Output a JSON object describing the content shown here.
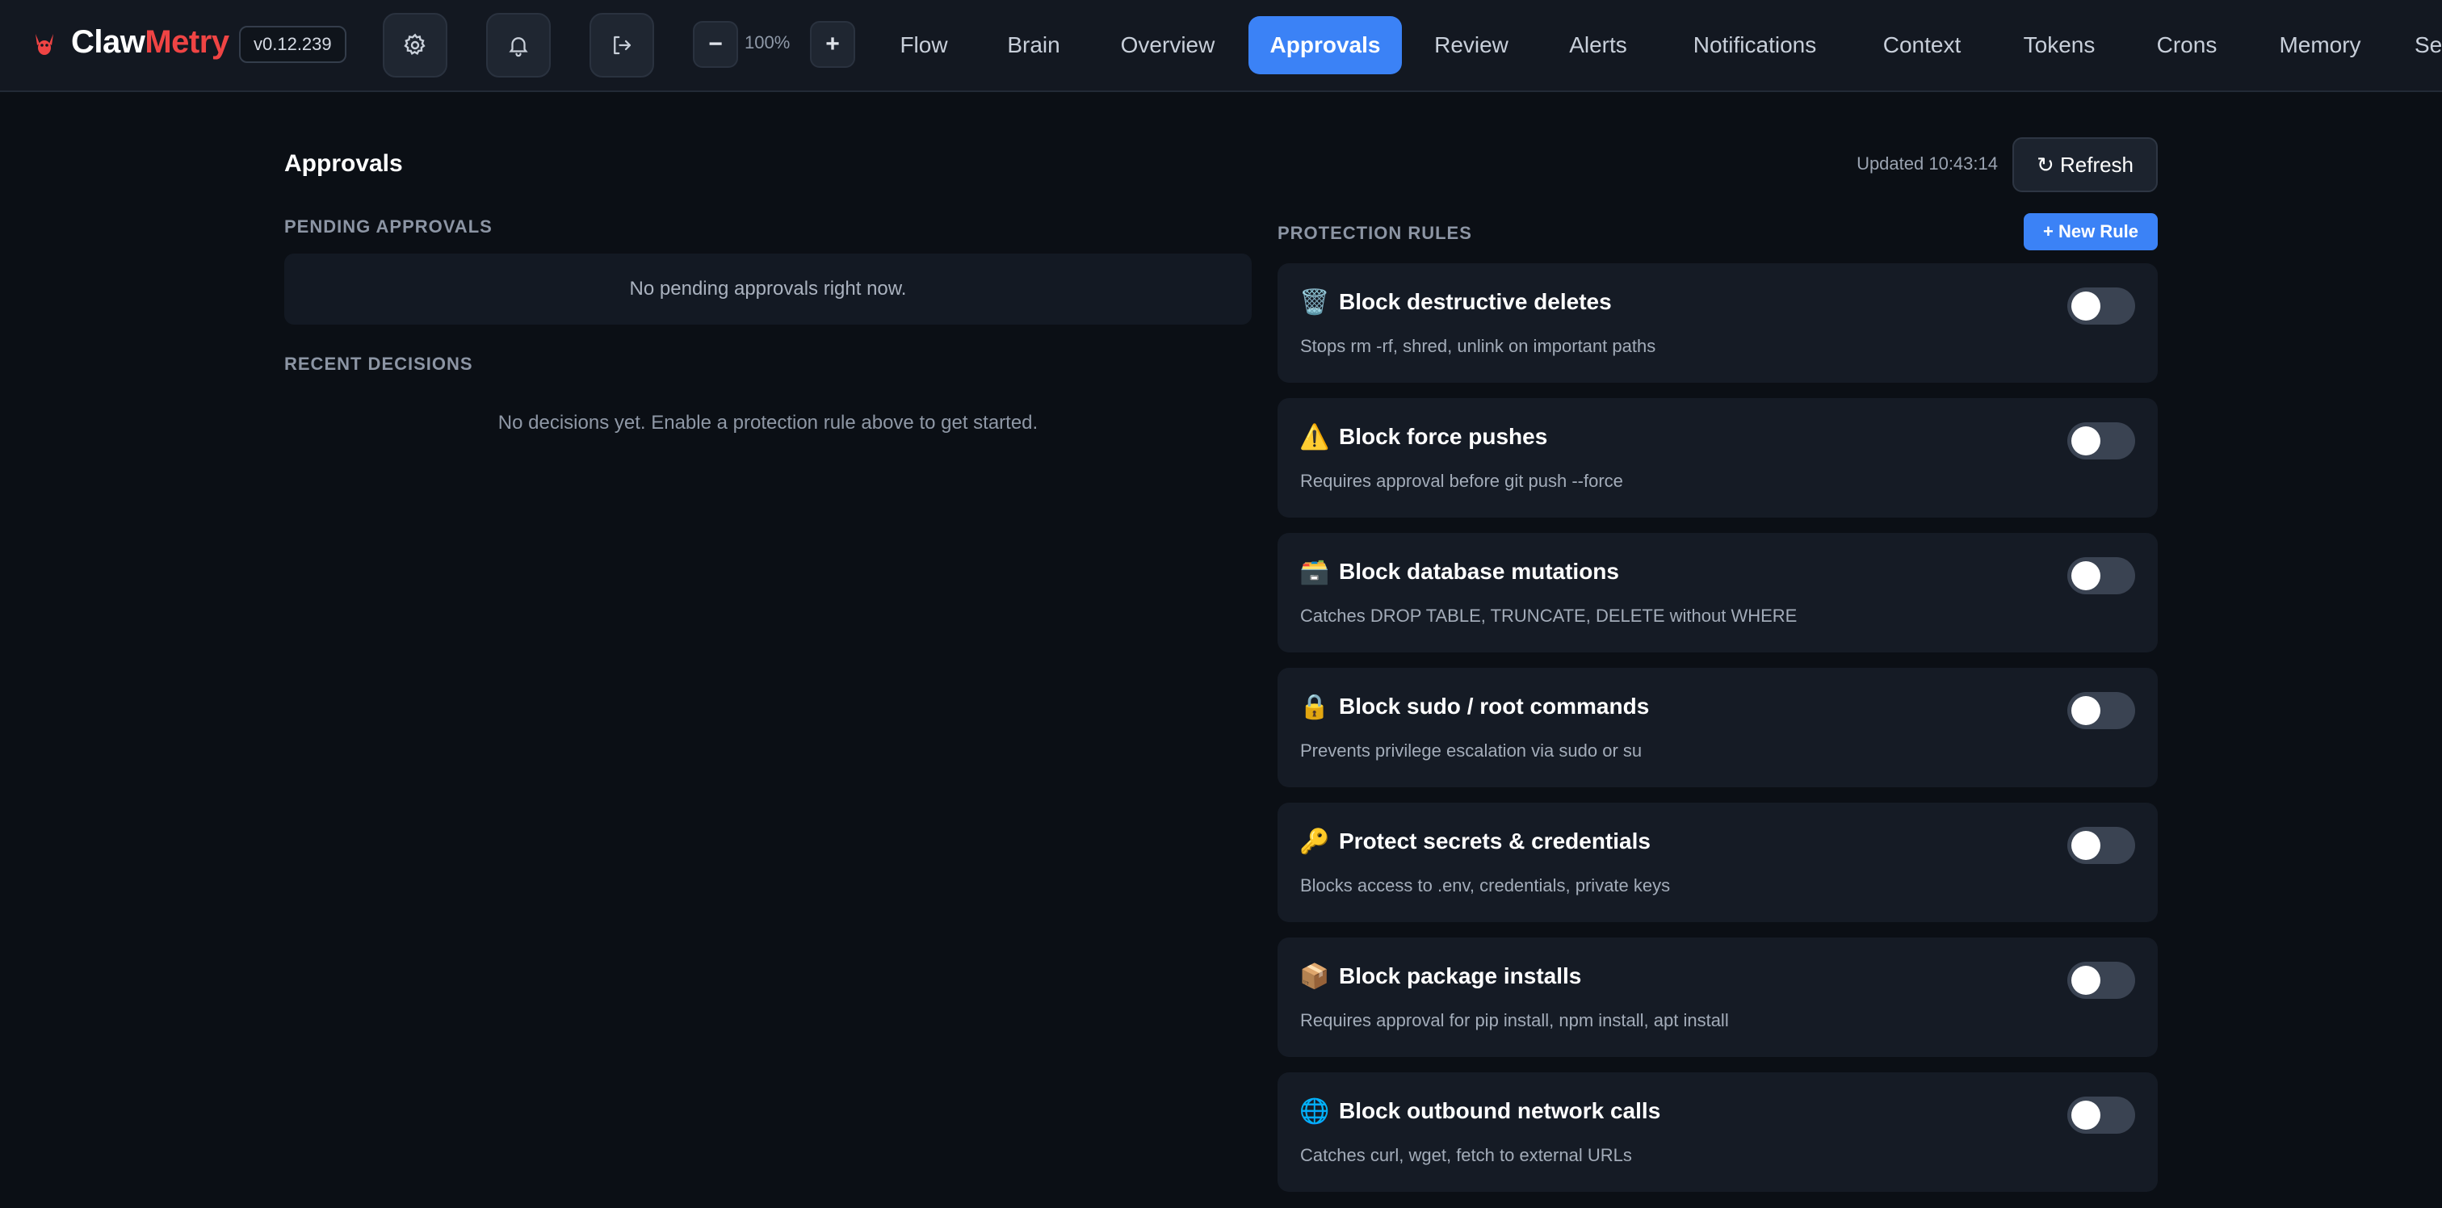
{
  "brand": {
    "name_part1": "Claw",
    "name_part2": "Metry",
    "version": "v0.12.239"
  },
  "toolbar": {
    "settings_icon": "gear-icon",
    "notifications_icon": "bell-icon",
    "logout_icon": "logout-icon",
    "zoom_out": "−",
    "zoom_level": "100%",
    "zoom_in": "+"
  },
  "tabs": [
    {
      "label": "Flow"
    },
    {
      "label": "Brain"
    },
    {
      "label": "Overview"
    },
    {
      "label": "Approvals",
      "active": true
    },
    {
      "label": "Review"
    },
    {
      "label": "Alerts"
    },
    {
      "label": "Notifications"
    },
    {
      "label": "Context"
    },
    {
      "label": "Tokens"
    },
    {
      "label": "Crons"
    },
    {
      "label": "Memory"
    },
    {
      "label": "Se"
    }
  ],
  "page": {
    "title": "Approvals",
    "updated": "Updated 10:43:14",
    "refresh_label": "↻ Refresh"
  },
  "pending": {
    "label": "PENDING APPROVALS",
    "empty": "No pending approvals right now."
  },
  "decisions": {
    "label": "RECENT DECISIONS",
    "empty": "No decisions yet. Enable a protection rule above to get started."
  },
  "rules": {
    "label": "PROTECTION RULES",
    "new_rule_label": "+ New Rule",
    "items": [
      {
        "emoji": "🗑️",
        "icon": "trash-icon",
        "title": "Block destructive deletes",
        "desc": "Stops rm -rf, shred, unlink on important paths",
        "enabled": false
      },
      {
        "emoji": "⚠️",
        "icon": "warning-icon",
        "title": "Block force pushes",
        "desc": "Requires approval before git push --force",
        "enabled": false
      },
      {
        "emoji": "🗃️",
        "icon": "database-icon",
        "title": "Block database mutations",
        "desc": "Catches DROP TABLE, TRUNCATE, DELETE without WHERE",
        "enabled": false
      },
      {
        "emoji": "🔒",
        "icon": "lock-icon",
        "title": "Block sudo / root commands",
        "desc": "Prevents privilege escalation via sudo or su",
        "enabled": false
      },
      {
        "emoji": "🔑",
        "icon": "key-icon",
        "title": "Protect secrets & credentials",
        "desc": "Blocks access to .env, credentials, private keys",
        "enabled": false
      },
      {
        "emoji": "📦",
        "icon": "package-icon",
        "title": "Block package installs",
        "desc": "Requires approval for pip install, npm install, apt install",
        "enabled": false
      },
      {
        "emoji": "🌐",
        "icon": "globe-icon",
        "title": "Block outbound network calls",
        "desc": "Catches curl, wget, fetch to external URLs",
        "enabled": false
      }
    ]
  },
  "colors": {
    "accent": "#3b82f6",
    "brand_red": "#ef4444",
    "background": "#0b0f15",
    "card": "#151b25"
  }
}
